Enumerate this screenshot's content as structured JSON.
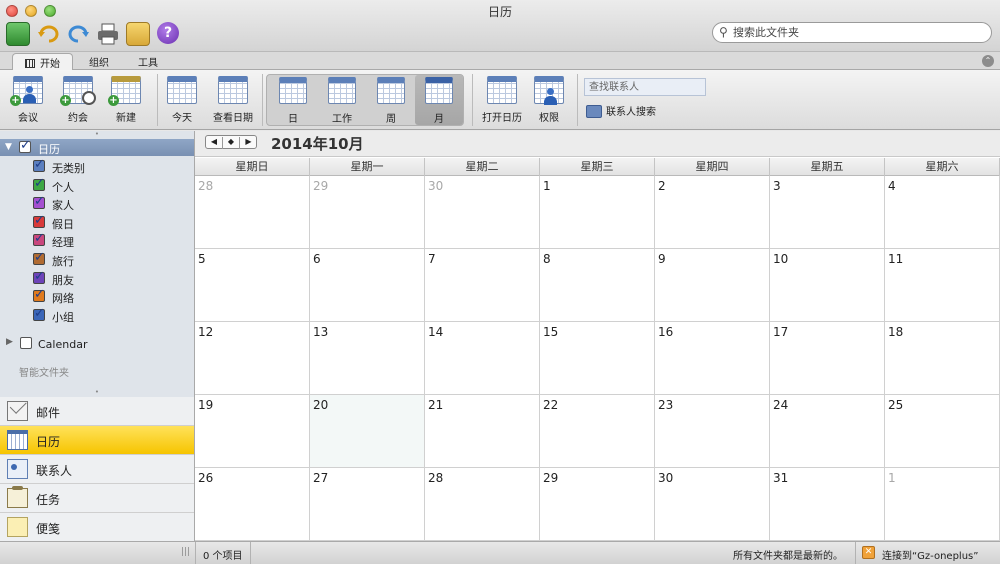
{
  "window": {
    "title": "日历"
  },
  "search": {
    "placeholder": "搜索此文件夹"
  },
  "ribbon_tabs": [
    {
      "label": "开始",
      "active": true
    },
    {
      "label": "组织",
      "active": false
    },
    {
      "label": "工具",
      "active": false
    }
  ],
  "ribbon": {
    "meeting": "会议",
    "appointment": "约会",
    "new": "新建",
    "today": "今天",
    "view_date": "查看日期",
    "day": "日",
    "work_week": "工作",
    "week": "周",
    "month": "月",
    "open_calendar": "打开日历",
    "permissions": "权限",
    "contact_lookup_placeholder": "查找联系人",
    "contact_search": "联系人搜索"
  },
  "sidebar": {
    "root_calendar": "日历",
    "categories": [
      {
        "label": "无类别",
        "color": "#5b7fbf"
      },
      {
        "label": "个人",
        "color": "#3ea845"
      },
      {
        "label": "家人",
        "color": "#a44fd0"
      },
      {
        "label": "假日",
        "color": "#d83a3a"
      },
      {
        "label": "经理",
        "color": "#c9477d"
      },
      {
        "label": "旅行",
        "color": "#b06b32"
      },
      {
        "label": "朋友",
        "color": "#6d43b8"
      },
      {
        "label": "网络",
        "color": "#e07a1d"
      },
      {
        "label": "小组",
        "color": "#3b66b8"
      }
    ],
    "secondary_calendar": "Calendar",
    "smart_folders": "智能文件夹",
    "nav": [
      {
        "label": "邮件",
        "icon": "mail-icon",
        "active": false
      },
      {
        "label": "日历",
        "icon": "calendar-icon",
        "active": true
      },
      {
        "label": "联系人",
        "icon": "contacts-icon",
        "active": false
      },
      {
        "label": "任务",
        "icon": "tasks-icon",
        "active": false
      },
      {
        "label": "便笺",
        "icon": "notes-icon",
        "active": false
      }
    ]
  },
  "calendar": {
    "month_title": "2014年10月",
    "weekdays": [
      "星期日",
      "星期一",
      "星期二",
      "星期三",
      "星期四",
      "星期五",
      "星期六"
    ],
    "weeks": [
      [
        {
          "d": "28",
          "out": true
        },
        {
          "d": "29",
          "out": true
        },
        {
          "d": "30",
          "out": true
        },
        {
          "d": "1"
        },
        {
          "d": "2"
        },
        {
          "d": "3"
        },
        {
          "d": "4"
        }
      ],
      [
        {
          "d": "5"
        },
        {
          "d": "6"
        },
        {
          "d": "7"
        },
        {
          "d": "8"
        },
        {
          "d": "9"
        },
        {
          "d": "10"
        },
        {
          "d": "11"
        }
      ],
      [
        {
          "d": "12"
        },
        {
          "d": "13"
        },
        {
          "d": "14"
        },
        {
          "d": "15"
        },
        {
          "d": "16"
        },
        {
          "d": "17"
        },
        {
          "d": "18"
        }
      ],
      [
        {
          "d": "19"
        },
        {
          "d": "20",
          "today": true
        },
        {
          "d": "21"
        },
        {
          "d": "22"
        },
        {
          "d": "23"
        },
        {
          "d": "24"
        },
        {
          "d": "25"
        }
      ],
      [
        {
          "d": "26"
        },
        {
          "d": "27"
        },
        {
          "d": "28"
        },
        {
          "d": "29"
        },
        {
          "d": "30"
        },
        {
          "d": "31"
        },
        {
          "d": "1",
          "out": true
        }
      ]
    ]
  },
  "status": {
    "item_count": "0 个项目",
    "sync_status": "所有文件夹都是最新的。",
    "connection": "连接到“Gz-oneplus”"
  }
}
